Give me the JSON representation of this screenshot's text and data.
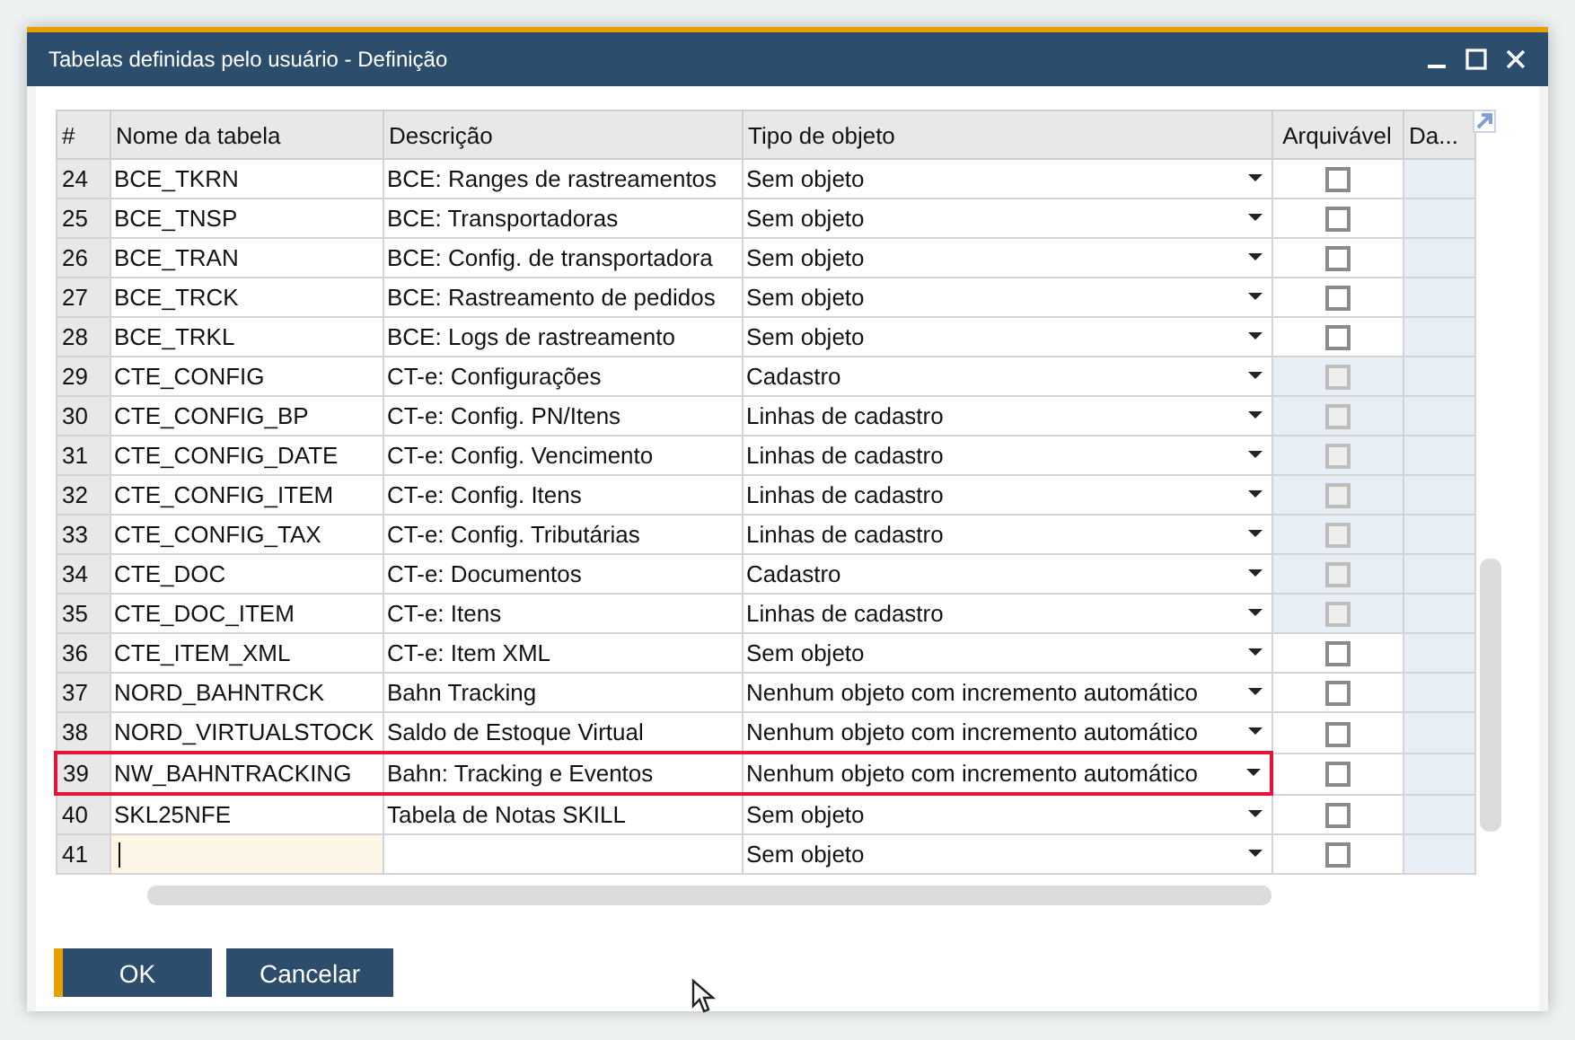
{
  "window": {
    "title": "Tabelas definidas pelo usuário - Definição"
  },
  "table": {
    "columns": [
      "#",
      "Nome da tabela",
      "Descrição",
      "Tipo de objeto",
      "Arquivável",
      "Da..."
    ],
    "rows": [
      {
        "number": "24",
        "name": "BCE_TKRN",
        "description": "BCE: Ranges de rastreamentos",
        "object_type": "Sem objeto",
        "archivable": {
          "checked": false,
          "disabled": false
        },
        "highlighted": false,
        "editing": false
      },
      {
        "number": "25",
        "name": "BCE_TNSP",
        "description": "BCE: Transportadoras",
        "object_type": "Sem objeto",
        "archivable": {
          "checked": false,
          "disabled": false
        },
        "highlighted": false,
        "editing": false
      },
      {
        "number": "26",
        "name": "BCE_TRAN",
        "description": "BCE: Config. de transportadora",
        "object_type": "Sem objeto",
        "archivable": {
          "checked": false,
          "disabled": false
        },
        "highlighted": false,
        "editing": false
      },
      {
        "number": "27",
        "name": "BCE_TRCK",
        "description": "BCE: Rastreamento de pedidos",
        "object_type": "Sem objeto",
        "archivable": {
          "checked": false,
          "disabled": false
        },
        "highlighted": false,
        "editing": false
      },
      {
        "number": "28",
        "name": "BCE_TRKL",
        "description": "BCE: Logs de rastreamento",
        "object_type": "Sem objeto",
        "archivable": {
          "checked": false,
          "disabled": false
        },
        "highlighted": false,
        "editing": false
      },
      {
        "number": "29",
        "name": "CTE_CONFIG",
        "description": "CT-e: Configurações",
        "object_type": "Cadastro",
        "archivable": {
          "checked": false,
          "disabled": true
        },
        "highlighted": false,
        "editing": false
      },
      {
        "number": "30",
        "name": "CTE_CONFIG_BP",
        "description": "CT-e: Config. PN/Itens",
        "object_type": "Linhas de cadastro",
        "archivable": {
          "checked": false,
          "disabled": true
        },
        "highlighted": false,
        "editing": false
      },
      {
        "number": "31",
        "name": "CTE_CONFIG_DATE",
        "description": "CT-e: Config. Vencimento",
        "object_type": "Linhas de cadastro",
        "archivable": {
          "checked": false,
          "disabled": true
        },
        "highlighted": false,
        "editing": false
      },
      {
        "number": "32",
        "name": "CTE_CONFIG_ITEM",
        "description": "CT-e: Config. Itens",
        "object_type": "Linhas de cadastro",
        "archivable": {
          "checked": false,
          "disabled": true
        },
        "highlighted": false,
        "editing": false
      },
      {
        "number": "33",
        "name": "CTE_CONFIG_TAX",
        "description": "CT-e: Config. Tributárias",
        "object_type": "Linhas de cadastro",
        "archivable": {
          "checked": false,
          "disabled": true
        },
        "highlighted": false,
        "editing": false
      },
      {
        "number": "34",
        "name": "CTE_DOC",
        "description": "CT-e: Documentos",
        "object_type": "Cadastro",
        "archivable": {
          "checked": false,
          "disabled": true
        },
        "highlighted": false,
        "editing": false
      },
      {
        "number": "35",
        "name": "CTE_DOC_ITEM",
        "description": "CT-e: Itens",
        "object_type": "Linhas de cadastro",
        "archivable": {
          "checked": false,
          "disabled": true
        },
        "highlighted": false,
        "editing": false
      },
      {
        "number": "36",
        "name": "CTE_ITEM_XML",
        "description": "CT-e: Item XML",
        "object_type": "Sem objeto",
        "archivable": {
          "checked": false,
          "disabled": false
        },
        "highlighted": false,
        "editing": false
      },
      {
        "number": "37",
        "name": "NORD_BAHNTRCK",
        "description": "Bahn Tracking",
        "object_type": "Nenhum objeto com incremento automático",
        "archivable": {
          "checked": false,
          "disabled": false
        },
        "highlighted": false,
        "editing": false
      },
      {
        "number": "38",
        "name": "NORD_VIRTUALSTOCK",
        "description": "Saldo de Estoque Virtual",
        "object_type": "Nenhum objeto com incremento automático",
        "archivable": {
          "checked": false,
          "disabled": false
        },
        "highlighted": false,
        "editing": false
      },
      {
        "number": "39",
        "name": "NW_BAHNTRACKING",
        "description": "Bahn: Tracking e Eventos",
        "object_type": "Nenhum objeto com incremento automático",
        "archivable": {
          "checked": false,
          "disabled": false
        },
        "highlighted": true,
        "editing": false
      },
      {
        "number": "40",
        "name": "SKL25NFE",
        "description": "Tabela de Notas SKILL",
        "object_type": "Sem objeto",
        "archivable": {
          "checked": false,
          "disabled": false
        },
        "highlighted": false,
        "editing": false
      },
      {
        "number": "41",
        "object_type": "Sem objeto",
        "archivable": {
          "checked": false,
          "disabled": false
        },
        "highlighted": false,
        "editing": true
      }
    ]
  },
  "buttons": [
    {
      "label": "OK",
      "default": true
    },
    {
      "label": "Cancelar",
      "default": false
    }
  ]
}
